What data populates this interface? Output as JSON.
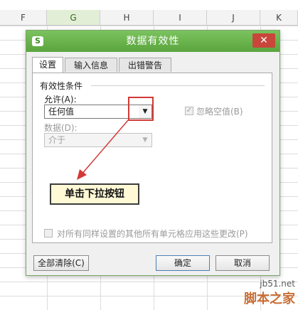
{
  "sheet": {
    "columns": [
      "F",
      "G",
      "H",
      "I",
      "J",
      "K"
    ],
    "selected_column": "G"
  },
  "dialog": {
    "title": "数据有效性",
    "app_icon": "S",
    "close_glyph": "✕",
    "tabs": [
      "设置",
      "输入信息",
      "出错警告"
    ],
    "group_title": "有效性条件",
    "allow_label": "允许(A):",
    "allow_value": "任何值",
    "ignore_blank_label": "忽略空值(B)",
    "data_label": "数据(D):",
    "data_value": "介于",
    "apply_all_label": "对所有同样设置的其他所有单元格应用这些更改(P)",
    "clear_all_button": "全部清除(C)",
    "ok_button": "确定",
    "cancel_button": "取消"
  },
  "annotation": {
    "callout_text": "单击下拉按钮"
  },
  "watermark": {
    "line1": "jb51.net",
    "line2": "脚本之家"
  },
  "colors": {
    "titlebar": "#5aa43d",
    "close_button": "#c9463b",
    "annotation": "#d23a36"
  }
}
